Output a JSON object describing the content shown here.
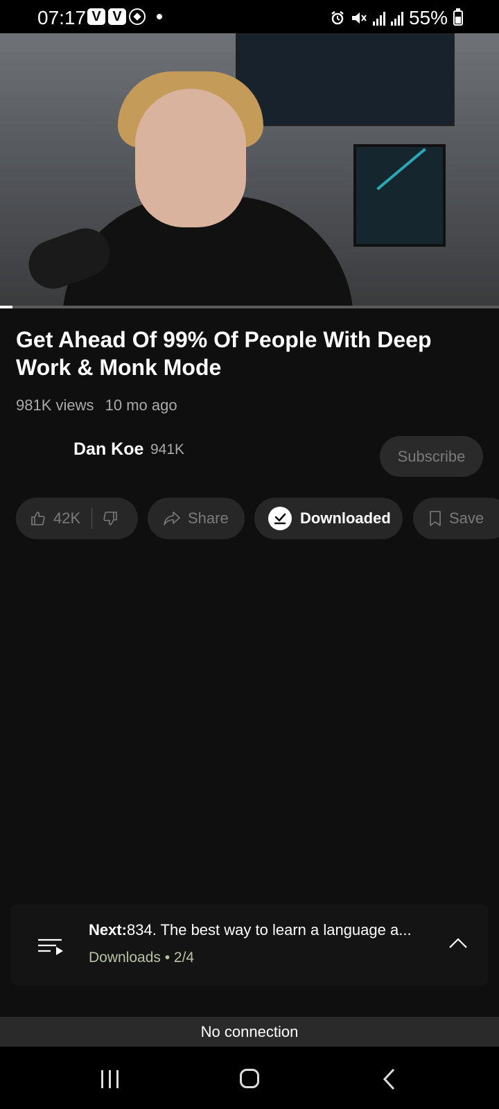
{
  "status_bar": {
    "time": "07:17",
    "left_icons": [
      "v-badge-icon",
      "v-badge-icon",
      "soccer-ball-icon",
      "dot-icon"
    ],
    "right_icons": [
      "alarm-icon",
      "mute-icon",
      "signal-icon",
      "signal-icon",
      "battery-icon"
    ],
    "battery": "55%"
  },
  "video": {
    "progress_fraction": 0.025
  },
  "info": {
    "title": "Get Ahead Of 99% Of People With Deep Work & Monk Mode",
    "views": "981K views",
    "age": "10 mo ago"
  },
  "channel": {
    "name": "Dan Koe",
    "subscribers": "941K",
    "subscribe_label": "Subscribe"
  },
  "actions": {
    "likes": "42K",
    "share_label": "Share",
    "downloaded_label": "Downloaded",
    "save_label": "Save"
  },
  "next": {
    "prefix": "Next:",
    "title": "834. The best way to learn a language a...",
    "playlist": "Downloads • 2/4"
  },
  "offline": {
    "message": "No connection"
  },
  "colors": {
    "background": "#0f0f0f",
    "pill": "#272727",
    "muted_text": "#aaaaaa",
    "playlist_text": "#b8c3a5"
  }
}
